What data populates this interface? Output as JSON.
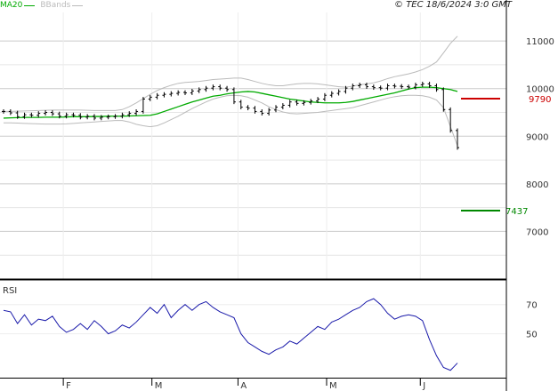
{
  "header": {
    "ma_label": "MA20",
    "bbands_label": "BBands",
    "source_label": "© TEC 18/6/2024 3:0 GMT"
  },
  "colors": {
    "price_bar": "#000000",
    "ma20": "#00aa00",
    "bbands": "#bbbbbb",
    "resistance": "#cc0000",
    "support": "#008800",
    "rsi": "#1a1aaa",
    "grid": "#cccccc",
    "frame": "#000000"
  },
  "chart_data": [
    {
      "type": "line",
      "subtype": "ohlc-bar",
      "x_months": [
        "F",
        "M",
        "A",
        "M",
        "J"
      ],
      "ylim": [
        6000,
        11600
      ],
      "y_ticks": [
        "11000",
        "10000",
        "9000",
        "8000",
        "7000"
      ],
      "grid": true,
      "series": [
        {
          "name": "MA20",
          "values": [
            9380,
            9385,
            9390,
            9395,
            9395,
            9395,
            9400,
            9400,
            9400,
            9405,
            9410,
            9410,
            9410,
            9415,
            9415,
            9420,
            9420,
            9420,
            9425,
            9430,
            9435,
            9440,
            9470,
            9520,
            9570,
            9620,
            9670,
            9720,
            9760,
            9800,
            9840,
            9860,
            9890,
            9910,
            9930,
            9940,
            9930,
            9900,
            9870,
            9840,
            9810,
            9780,
            9760,
            9740,
            9720,
            9710,
            9700,
            9700,
            9700,
            9710,
            9730,
            9760,
            9790,
            9820,
            9850,
            9880,
            9910,
            9950,
            9990,
            10020,
            10030,
            10030,
            10020,
            10000,
            9980,
            9940
          ]
        },
        {
          "name": "BBands",
          "values": [
            9280,
            9280,
            9275,
            9270,
            9265,
            9260,
            9255,
            9255,
            9255,
            9260,
            9270,
            9280,
            9290,
            9300,
            9310,
            9320,
            9330,
            9330,
            9300,
            9250,
            9220,
            9200,
            9220,
            9280,
            9350,
            9420,
            9500,
            9580,
            9650,
            9720,
            9780,
            9820,
            9850,
            9860,
            9850,
            9820,
            9760,
            9700,
            9620,
            9560,
            9510,
            9480,
            9470,
            9480,
            9490,
            9500,
            9520,
            9540,
            9560,
            9580,
            9600,
            9640,
            9680,
            9720,
            9760,
            9800,
            9830,
            9850,
            9860,
            9860,
            9850,
            9820,
            9760,
            9600,
            9200,
            8800
          ]
        },
        {
          "name": "BBands",
          "values": [
            9520,
            9520,
            9525,
            9530,
            9535,
            9540,
            9545,
            9550,
            9550,
            9550,
            9550,
            9550,
            9545,
            9540,
            9540,
            9540,
            9540,
            9560,
            9620,
            9700,
            9790,
            9880,
            9960,
            10020,
            10070,
            10110,
            10130,
            10140,
            10150,
            10170,
            10190,
            10200,
            10210,
            10220,
            10220,
            10190,
            10150,
            10110,
            10080,
            10060,
            10060,
            10080,
            10100,
            10110,
            10110,
            10100,
            10080,
            10060,
            10040,
            10030,
            10050,
            10080,
            10100,
            10120,
            10160,
            10210,
            10250,
            10280,
            10310,
            10350,
            10400,
            10470,
            10560,
            10750,
            10950,
            11100
          ]
        }
      ],
      "ohlc_close": [
        9520,
        9490,
        9410,
        9450,
        9440,
        9480,
        9500,
        9470,
        9420,
        9450,
        9440,
        9400,
        9420,
        9380,
        9400,
        9410,
        9420,
        9450,
        9480,
        9520,
        9780,
        9820,
        9860,
        9880,
        9900,
        9920,
        9910,
        9950,
        9980,
        10010,
        10040,
        10010,
        9980,
        9720,
        9610,
        9590,
        9520,
        9480,
        9550,
        9610,
        9650,
        9720,
        9690,
        9710,
        9740,
        9780,
        9860,
        9900,
        9940,
        10010,
        10060,
        10080,
        10040,
        10020,
        10010,
        10060,
        10050,
        10040,
        10030,
        10080,
        10100,
        10060,
        9980,
        9560,
        9120,
        8760
      ],
      "annotations": [
        {
          "label": "9790",
          "value": 9790,
          "role": "resistance"
        },
        {
          "label": "7437",
          "value": 7437,
          "role": "support"
        }
      ]
    },
    {
      "type": "line",
      "title": "RSI",
      "ylim": [
        20,
        85
      ],
      "y_ticks": [
        "70",
        "50"
      ],
      "series": [
        {
          "name": "",
          "values": [
            66,
            65,
            57,
            63,
            56,
            60,
            59,
            62,
            55,
            51,
            53,
            57,
            53,
            59,
            55,
            50,
            52,
            56,
            54,
            58,
            63,
            68,
            64,
            70,
            61,
            66,
            70,
            66,
            70,
            72,
            68,
            65,
            63,
            61,
            50,
            44,
            41,
            38,
            36,
            39,
            41,
            45,
            43,
            47,
            51,
            55,
            53,
            58,
            60,
            63,
            66,
            68,
            72,
            74,
            70,
            64,
            60,
            62,
            63,
            62,
            59,
            46,
            35,
            27,
            25,
            30
          ]
        }
      ]
    }
  ]
}
